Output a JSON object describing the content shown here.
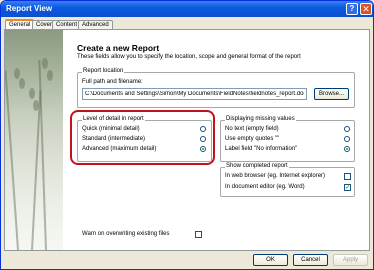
{
  "window": {
    "title": "Report View",
    "help_glyph": "?",
    "close_glyph": "✕"
  },
  "tabs": [
    "General",
    "Cover",
    "Content",
    "Advanced"
  ],
  "header": {
    "title": "Create a new Report",
    "intro": "These fields allow you to specify the location, scope and general format of the report"
  },
  "location": {
    "group_title": "Report location",
    "label": "Full path and filename:",
    "value": "C:\\Documents and Settings\\Simon\\My Documents\\FieldNotes\\fieldnotes_report.doc",
    "browse_label": "Browse..."
  },
  "detail": {
    "group_title": "Level of detail in report",
    "options": [
      "Quick  (minimal detail)",
      "Standard  (intermediate)",
      "Advanced  (maximum detail)"
    ],
    "selected": 2
  },
  "missing": {
    "group_title": "Displaying missing values",
    "options": [
      "No text (empty field)",
      "Use empty quotes \"\"",
      "Label field \"No information\""
    ],
    "selected": 2
  },
  "show": {
    "group_title": "Show completed report",
    "options": [
      "In web browser (eg. Internet explorer)",
      "In document editor (eg. Word)"
    ],
    "checked": [
      false,
      true
    ]
  },
  "warn_label": "Warn on overwriting existing files",
  "buttons": {
    "ok": "OK",
    "cancel": "Cancel",
    "apply": "Apply"
  },
  "colors": {
    "titlebar": "#0a5ae0",
    "highlight": "#c0141c",
    "tab_accent": "#e68b2c"
  }
}
